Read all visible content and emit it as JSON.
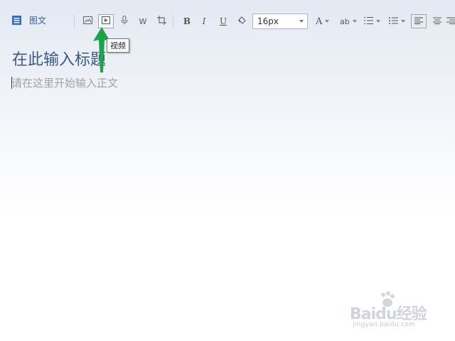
{
  "editor": {
    "doc_type_label": "图文",
    "title_placeholder": "在此输入标题",
    "body_placeholder": "请在这里开始输入正文"
  },
  "toolbar": {
    "image_icon": "image-icon",
    "video_icon": "video-icon",
    "audio_icon": "microphone-icon",
    "word_label": "W",
    "crop_icon": "crop-icon",
    "bold_label": "B",
    "italic_label": "I",
    "underline_label": "U",
    "eraser_icon": "eraser-icon",
    "font_size_value": "16px",
    "font_color_label": "A",
    "highlight_label": "ab",
    "ordered_list_icon": "ordered-list-icon",
    "unordered_list_icon": "unordered-list-icon",
    "align_left_icon": "align-left-icon",
    "align_center_icon": "align-center-icon",
    "align_right_icon": "align-right-icon"
  },
  "tooltip": {
    "text": "视频"
  },
  "watermark": {
    "main": "Baidu经验",
    "sub": "jingyan.baidu.com"
  },
  "colors": {
    "accent": "#2f5f9f",
    "title_text": "#3b5a82",
    "placeholder_text": "#9ba3ad",
    "arrow": "#1fa34a"
  }
}
